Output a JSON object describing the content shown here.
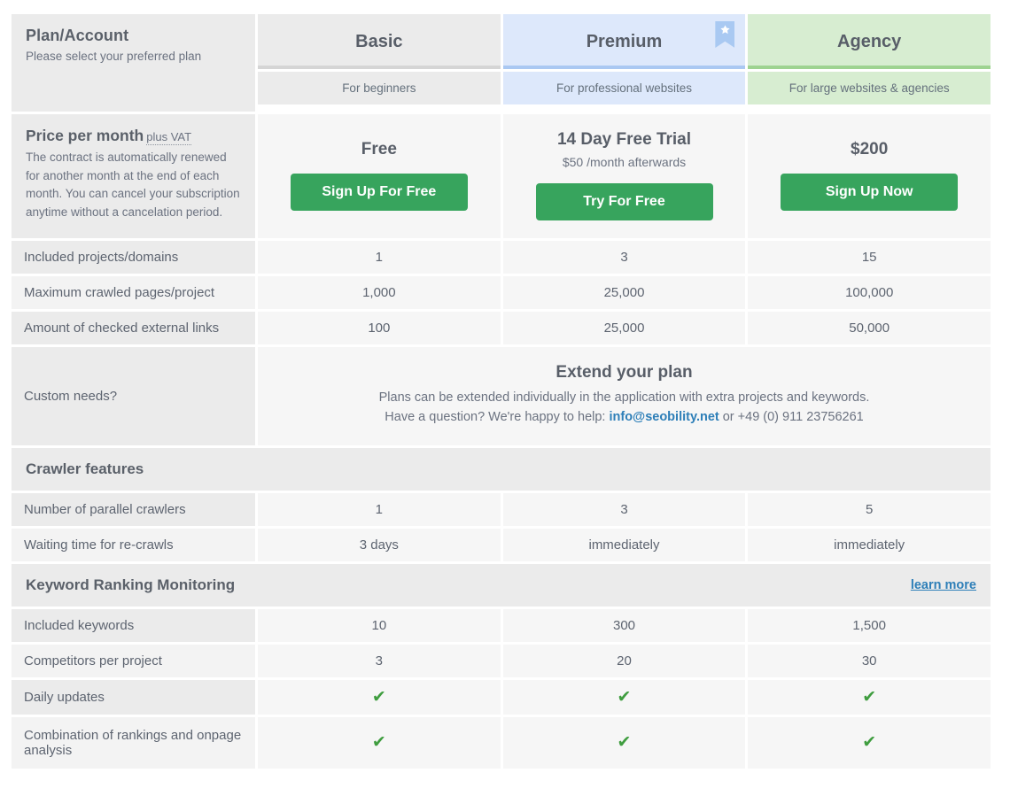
{
  "header": {
    "left_title": "Plan/Account",
    "left_subtitle": "Please select your preferred plan",
    "plans": [
      {
        "name": "Basic",
        "tagline": "For beginners",
        "featured": false
      },
      {
        "name": "Premium",
        "tagline": "For professional websites",
        "featured": true
      },
      {
        "name": "Agency",
        "tagline": "For large websites & agencies",
        "featured": false
      }
    ]
  },
  "price": {
    "title": "Price per month",
    "vat_note": "plus VAT",
    "description": "The contract is automatically renewed for another month at the end of each month. You can cancel your subscription anytime without a cancelation period.",
    "columns": [
      {
        "headline": "Free",
        "note": "",
        "cta": "Sign Up For Free"
      },
      {
        "headline": "14 Day Free Trial",
        "note": "$50 /month afterwards",
        "cta": "Try For Free"
      },
      {
        "headline": "$200",
        "note": "",
        "cta": "Sign Up Now"
      }
    ]
  },
  "core_rows": [
    {
      "label": "Included projects/domains",
      "values": [
        "1",
        "3",
        "15"
      ]
    },
    {
      "label": "Maximum crawled pages/project",
      "values": [
        "1,000",
        "25,000",
        "100,000"
      ]
    },
    {
      "label": "Amount of checked external links",
      "values": [
        "100",
        "25,000",
        "50,000"
      ]
    }
  ],
  "custom": {
    "label": "Custom needs?",
    "title": "Extend your plan",
    "line1": "Plans can be extended individually in the application with extra projects and keywords.",
    "line2_prefix": "Have a question? We're happy to help: ",
    "email": "info@seobility.net",
    "line2_suffix": " or +49 (0) 911 23756261"
  },
  "crawler_section": {
    "title": "Crawler features",
    "rows": [
      {
        "label": "Number of parallel crawlers",
        "values": [
          "1",
          "3",
          "5"
        ]
      },
      {
        "label": "Waiting time for re-crawls",
        "values": [
          "3 days",
          "immediately",
          "immediately"
        ]
      }
    ]
  },
  "keyword_section": {
    "title": "Keyword Ranking Monitoring",
    "link": "learn more",
    "rows": [
      {
        "label": "Included keywords",
        "values": [
          "10",
          "300",
          "1,500"
        ]
      },
      {
        "label": "Competitors per project",
        "values": [
          "3",
          "20",
          "30"
        ]
      },
      {
        "label": "Daily updates",
        "values": [
          "✔",
          "✔",
          "✔"
        ]
      },
      {
        "label": "Combination of rankings and onpage analysis",
        "values": [
          "✔",
          "✔",
          "✔"
        ]
      }
    ]
  },
  "colors": {
    "cta_green": "#37a45d",
    "check_green": "#3f9d3f",
    "link_blue": "#2e7fb8",
    "premium_bg": "#dde8fb",
    "agency_bg": "#d7edd1",
    "basic_bg": "#ebebeb"
  },
  "icons": {
    "star": "star-icon",
    "check": "check-icon"
  }
}
